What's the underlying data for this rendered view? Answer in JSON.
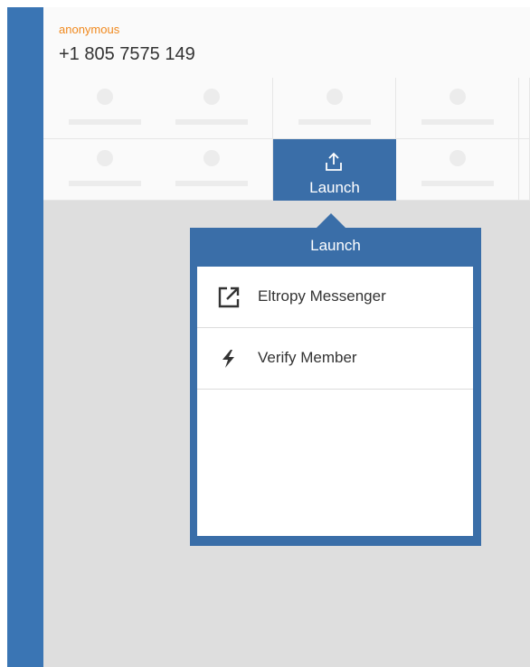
{
  "caller": {
    "name": "anonymous",
    "number": "+1 805 7575 149"
  },
  "grid": {
    "active_tile_label": "Launch",
    "active_tile_icon": "launch-upload-icon"
  },
  "popover": {
    "title": "Launch",
    "items": [
      {
        "label": "Eltropy Messenger",
        "icon": "external-link-icon"
      },
      {
        "label": "Verify Member",
        "icon": "lightning-bolt-icon"
      }
    ]
  },
  "colors": {
    "sidebar": "#3a75b4",
    "accent_blue": "#3a6ea8",
    "caller_name": "#f0891e",
    "background": "#dedede"
  }
}
